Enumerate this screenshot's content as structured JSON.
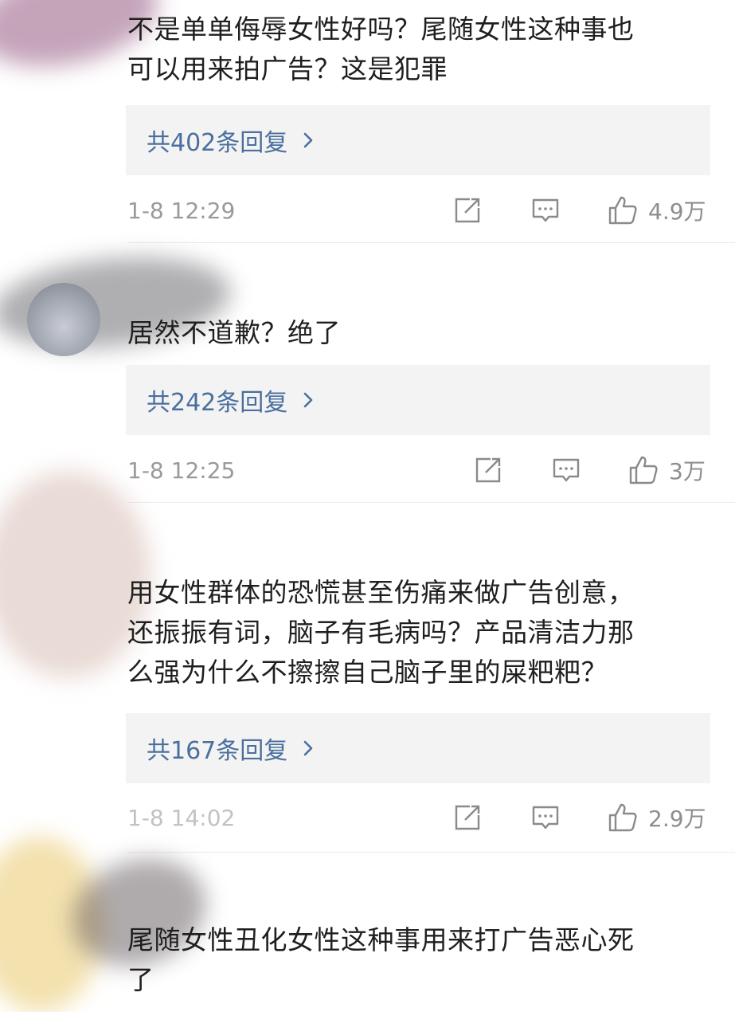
{
  "comments": [
    {
      "text": "不是单单侮辱女性好吗？尾随女性这种事也\n可以用来拍广告？这是犯罪",
      "replies_label": "共402条回复",
      "time": "1-8 12:29",
      "likes": "4.9万"
    },
    {
      "text": "居然不道歉？绝了",
      "replies_label": "共242条回复",
      "time": "1-8 12:25",
      "likes": "3万"
    },
    {
      "text": "用女性群体的恐慌甚至伤痛来做广告创意，\n还振振有词，脑子有毛病吗？产品清洁力那\n么强为什么不擦擦自己脑子里的屎粑粑？",
      "replies_label": "共167条回复",
      "time": "1-8 14:02",
      "likes": "2.9万"
    },
    {
      "text": "尾随女性丑化女性这种事用来打广告恶心死\n了"
    }
  ],
  "icons": {
    "share": "share-icon",
    "comment": "comment-icon",
    "like": "thumbs-up-icon",
    "chevron": "chevron-right-icon"
  },
  "colors": {
    "reply_link": "#4a6f9e",
    "reply_bg": "#f3f3f3",
    "meta_text": "#9a9a9a",
    "icon": "#8a8a8a"
  }
}
